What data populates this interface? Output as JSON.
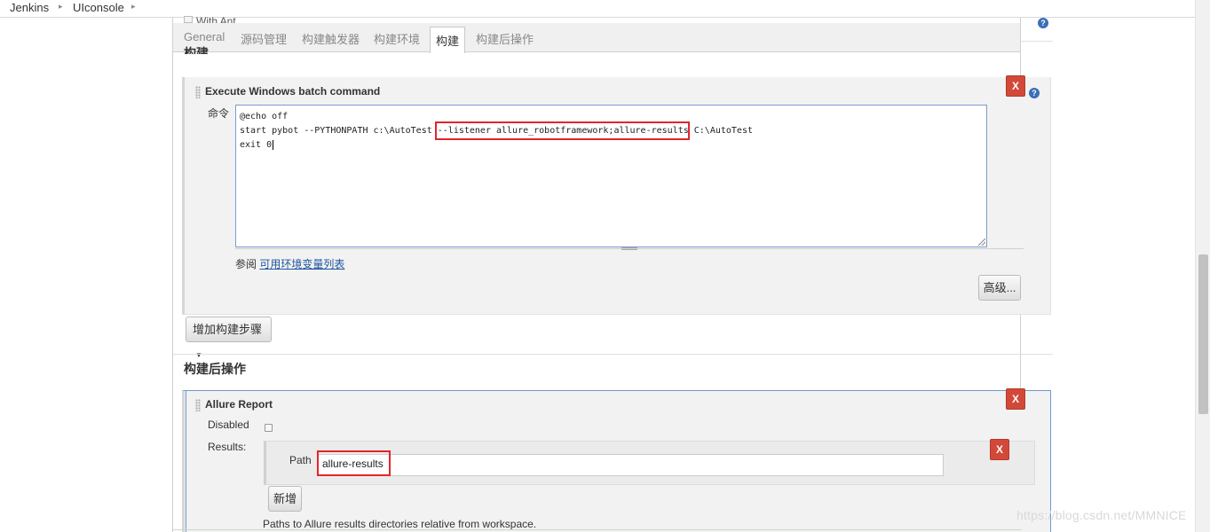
{
  "breadcrumb": {
    "items": [
      "Jenkins",
      "UIconsole"
    ]
  },
  "hidden_text": "With Ant",
  "tabs": [
    {
      "label": "General"
    },
    {
      "label": "源码管理"
    },
    {
      "label": "构建触发器"
    },
    {
      "label": "构建环境"
    },
    {
      "label": "构建",
      "active": true
    },
    {
      "label": "构建后操作"
    }
  ],
  "build": {
    "section_title": "构建",
    "step_title": "Execute Windows batch command",
    "command_label": "命令",
    "command_lines": {
      "line1": "@echo off",
      "line2_prefix": "start pybot --PYTHONPATH c:\\AutoTest ",
      "line2_highlight": "--listener allure_robotframework;allure-results",
      "line2_suffix": " C:\\AutoTest",
      "line3": "exit 0"
    },
    "see_text": "参阅",
    "env_vars_link": "可用环境变量列表",
    "advanced_button": "高级...",
    "add_step_button": "增加构建步骤"
  },
  "post_build": {
    "section_title": "构建后操作",
    "step_title": "Allure Report",
    "disabled_label": "Disabled",
    "results_label": "Results:",
    "path_label": "Path",
    "path_value": "allure-results",
    "add_button": "新增",
    "help_text": "Paths to Allure results directories relative from workspace."
  },
  "delete_label": "X",
  "watermark": "https://blog.csdn.net/MMNICE",
  "colors": {
    "delete": "#d24939",
    "highlight": "#e2252b",
    "link": "#1e56a0",
    "textarea_border": "#7a9cd3"
  }
}
